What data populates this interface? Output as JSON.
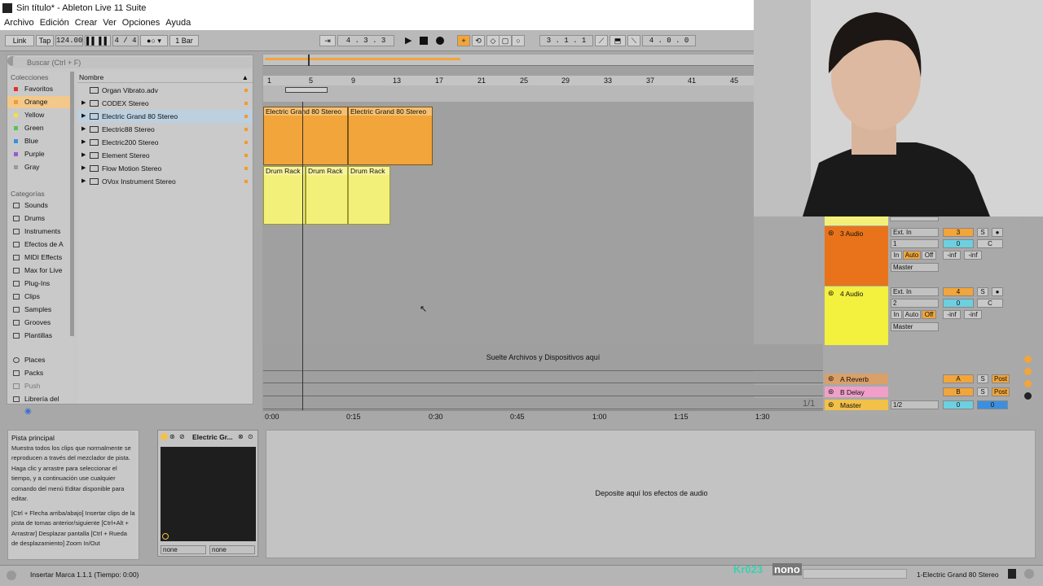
{
  "window": {
    "title": "Sin título* - Ableton Live 11 Suite"
  },
  "menu": [
    "Archivo",
    "Edición",
    "Crear",
    "Ver",
    "Opciones",
    "Ayuda"
  ],
  "toolbar": {
    "link": "Link",
    "tap": "Tap",
    "tempo": "124.00",
    "time_sig": "4 / 4",
    "quant": "1 Bar",
    "position": "4 .  3 .  3",
    "loop_start": "3 .  1 .  1",
    "loop_len": "4 .  0 .  0"
  },
  "browser": {
    "search_placeholder": "Buscar (Ctrl + F)",
    "collections_title": "Colecciones",
    "collections": [
      {
        "label": "Favoritos",
        "color": "#e0302a"
      },
      {
        "label": "Orange",
        "color": "#f29b2e"
      },
      {
        "label": "Yellow",
        "color": "#f3e23a"
      },
      {
        "label": "Green",
        "color": "#57c25a"
      },
      {
        "label": "Blue",
        "color": "#3b8fe0"
      },
      {
        "label": "Purple",
        "color": "#9a5ad0"
      },
      {
        "label": "Gray",
        "color": "#9a9a9a"
      }
    ],
    "categories_title": "Categorías",
    "categories": [
      "Sounds",
      "Drums",
      "Instruments",
      "Efectos de A",
      "MIDI Effects",
      "Max for Live",
      "Plug-Ins",
      "Clips",
      "Samples",
      "Grooves",
      "Plantillas"
    ],
    "places": [
      "Places",
      "Packs",
      "Push",
      "Librería del"
    ],
    "list_header": "Nombre",
    "files": [
      {
        "label": "Organ Vibrato.adv",
        "expand": false
      },
      {
        "label": "CODEX Stereo",
        "expand": true
      },
      {
        "label": "Electric Grand 80 Stereo",
        "expand": true
      },
      {
        "label": "Electric88 Stereo",
        "expand": true
      },
      {
        "label": "Electric200 Stereo",
        "expand": true
      },
      {
        "label": "Element Stereo",
        "expand": true
      },
      {
        "label": "Flow Motion Stereo",
        "expand": true
      },
      {
        "label": "OVox Instrument Stereo",
        "expand": true
      }
    ]
  },
  "ruler": [
    "1",
    "5",
    "9",
    "13",
    "17",
    "21",
    "25",
    "29",
    "33",
    "37",
    "41",
    "45"
  ],
  "clips": {
    "track1": [
      "Electric Grand 80 Stereo",
      "Electric Grand 80 Stereo"
    ],
    "track2": [
      "Drum Rack",
      "Drum Rack",
      "Drum Rack"
    ]
  },
  "drop_files": "Suelte Archivos y Dispositivos aquí",
  "timeline": [
    "0:00",
    "0:15",
    "0:30",
    "0:45",
    "1:00",
    "1:15",
    "1:30"
  ],
  "page_indicator": "1/1",
  "mixer": {
    "tracks": [
      {
        "name": "3 Audio",
        "color": "#e8731a",
        "input": "Ext. In",
        "channel": "1",
        "num": "3",
        "vol": "0",
        "pan": "C",
        "mon_in": "In",
        "mon_auto": "Auto",
        "mon_off": "Off",
        "inf1": "-inf",
        "inf2": "-inf",
        "out": "Master"
      },
      {
        "name": "4 Audio",
        "color": "#f3f03e",
        "input": "Ext. In",
        "channel": "2",
        "num": "4",
        "vol": "0",
        "pan": "C",
        "mon_in": "In",
        "mon_auto": "Auto",
        "mon_off": "Off",
        "inf1": "-inf",
        "inf2": "-inf",
        "out": "Master"
      }
    ],
    "returns": [
      {
        "name": "A Reverb",
        "color": "#d9a06a",
        "letter": "A",
        "post": "Post"
      },
      {
        "name": "B Delay",
        "color": "#f0a0c8",
        "letter": "B",
        "post": "Post"
      }
    ],
    "master": {
      "name": "Master",
      "color": "#f2c14a",
      "cue": "1/2",
      "vol": "0",
      "vol2": "0"
    },
    "solo": "S"
  },
  "info": {
    "title": "Pista principal",
    "body": "Muestra todos los clips que normalmente se reproducen a través del mezclador de pista. Haga clic y arrastre para seleccionar el tiempo, y a continuación use cualquier comando del menú Editar disponible para editar.",
    "shortcuts": "[Ctrl + Flecha arriba/abajo] Insertar clips de la pista de tomas anterior/siguiente [Ctrl+Alt + Arrastrar] Desplazar pantalla [Ctrl + Rueda de desplazamiento] Zoom In/Out"
  },
  "device": {
    "title": "Electric Gr...",
    "sel1": "none",
    "sel2": "none"
  },
  "fx_drop": "Deposite aquí los efectos de audio",
  "status": {
    "message": "Insertar Marca 1.1.1 (Tiempo: 0:00)",
    "overlay1": "Kr023",
    "overlay2": "nono",
    "selected": "1-Electric Grand 80 Stereo"
  }
}
